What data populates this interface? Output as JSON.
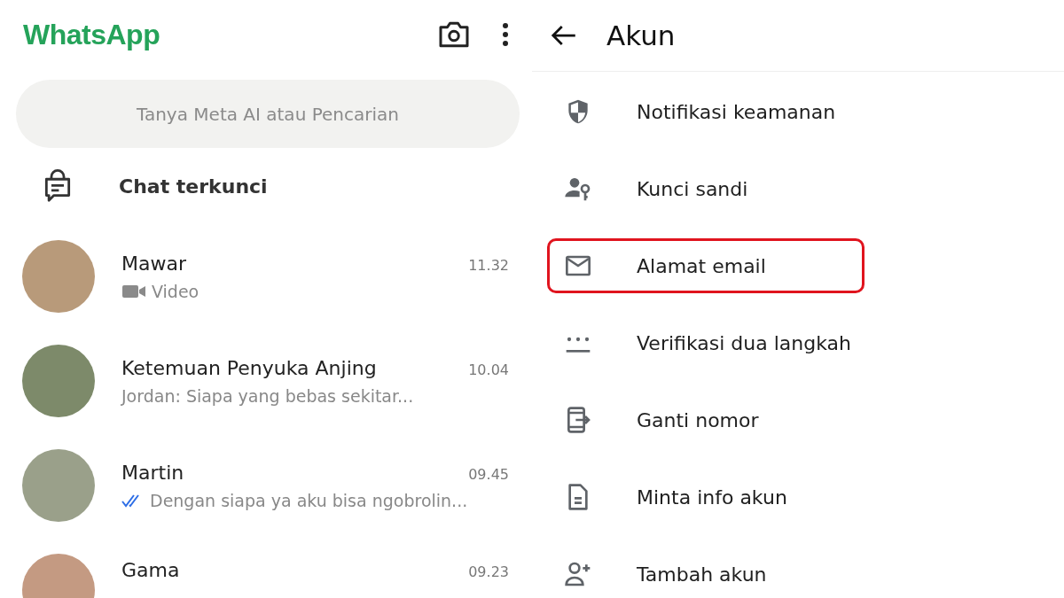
{
  "chats_screen": {
    "app_title": "WhatsApp",
    "search": {
      "placeholder": "Tanya Meta AI atau Pencarian"
    },
    "locked_chats": {
      "label": "Chat terkunci"
    },
    "chats": [
      {
        "name": "Mawar",
        "time": "11.32",
        "preview": "Video",
        "kind": "video"
      },
      {
        "name": "Ketemuan Penyuka Anjing",
        "time": "10.04",
        "preview": "Jordan: Siapa yang bebas sekitar...",
        "kind": "text"
      },
      {
        "name": "Martin",
        "time": "09.45",
        "preview": "Dengan siapa ya aku bisa ngobrolin...",
        "kind": "read"
      },
      {
        "name": "Gama",
        "time": "09.23"
      }
    ]
  },
  "account_screen": {
    "title": "Akun",
    "items": [
      {
        "label": "Notifikasi keamanan",
        "highlighted": false
      },
      {
        "label": "Kunci sandi",
        "highlighted": false
      },
      {
        "label": "Alamat email",
        "highlighted": true
      },
      {
        "label": "Verifikasi dua langkah",
        "highlighted": false
      },
      {
        "label": "Ganti nomor",
        "highlighted": false
      },
      {
        "label": "Minta info akun",
        "highlighted": false
      },
      {
        "label": "Tambah akun",
        "highlighted": false
      }
    ]
  }
}
